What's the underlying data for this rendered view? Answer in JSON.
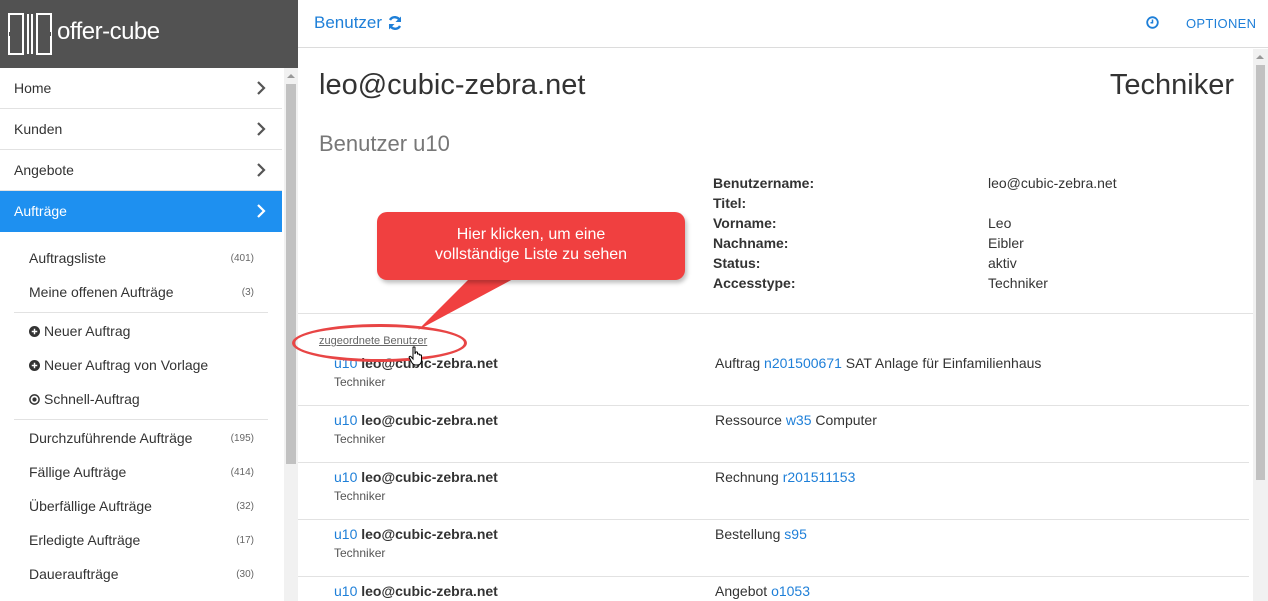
{
  "brand": {
    "name": "offer-cube"
  },
  "nav": {
    "items": [
      {
        "label": "Home"
      },
      {
        "label": "Kunden"
      },
      {
        "label": "Angebote"
      },
      {
        "label": "Aufträge"
      }
    ]
  },
  "subnav": {
    "auftragsliste": {
      "label": "Auftragsliste",
      "count": "(401)"
    },
    "meine_offenen": {
      "label": "Meine offenen Aufträge",
      "count": "(3)"
    },
    "neuer_auftrag": {
      "label": "Neuer Auftrag"
    },
    "neuer_auftrag_vorlage": {
      "label": "Neuer Auftrag von Vorlage"
    },
    "schnell_auftrag": {
      "label": "Schnell-Auftrag"
    },
    "durchzufuehrende": {
      "label": "Durchzuführende Aufträge",
      "count": "(195)"
    },
    "faellige": {
      "label": "Fällige Aufträge",
      "count": "(414)"
    },
    "ueberfaellige": {
      "label": "Überfällige Aufträge",
      "count": "(32)"
    },
    "erledigte": {
      "label": "Erledigte Aufträge",
      "count": "(17)"
    },
    "dauer": {
      "label": "Daueraufträge",
      "count": "(30)"
    }
  },
  "topbar": {
    "title": "Benutzer",
    "options_label": "OPTIONEN"
  },
  "user": {
    "email": "leo@cubic-zebra.net",
    "role": "Techniker",
    "subtitle": "Benutzer u10",
    "details": [
      {
        "key": "Benutzername:",
        "value": "leo@cubic-zebra.net"
      },
      {
        "key": "Titel:",
        "value": ""
      },
      {
        "key": "Vorname:",
        "value": "Leo"
      },
      {
        "key": "Nachname:",
        "value": "Eibler"
      },
      {
        "key": "Status:",
        "value": "aktiv"
      },
      {
        "key": "Accesstype:",
        "value": "Techniker"
      }
    ]
  },
  "assigned": {
    "link_label": "zugeordnete Benutzer",
    "rows": [
      {
        "id": "u10",
        "mail": "leo@cubic-zebra.net",
        "role": "Techniker",
        "type": "Auftrag",
        "ref": "n201500671",
        "desc": "SAT Anlage für Einfamilienhaus"
      },
      {
        "id": "u10",
        "mail": "leo@cubic-zebra.net",
        "role": "Techniker",
        "type": "Ressource",
        "ref": "w35",
        "desc": "Computer"
      },
      {
        "id": "u10",
        "mail": "leo@cubic-zebra.net",
        "role": "Techniker",
        "type": "Rechnung",
        "ref": "r201511153",
        "desc": ""
      },
      {
        "id": "u10",
        "mail": "leo@cubic-zebra.net",
        "role": "Techniker",
        "type": "Bestellung",
        "ref": "s95",
        "desc": ""
      },
      {
        "id": "u10",
        "mail": "leo@cubic-zebra.net",
        "role": "",
        "type": "Angebot",
        "ref": "o1053",
        "desc": ""
      }
    ]
  },
  "callout": {
    "line1": "Hier klicken, um eine",
    "line2": "vollständige Liste zu sehen"
  },
  "colors": {
    "accent": "#1e90f0",
    "link": "#1e7fd8",
    "callout": "#f04040",
    "brand_bg": "#525252"
  }
}
